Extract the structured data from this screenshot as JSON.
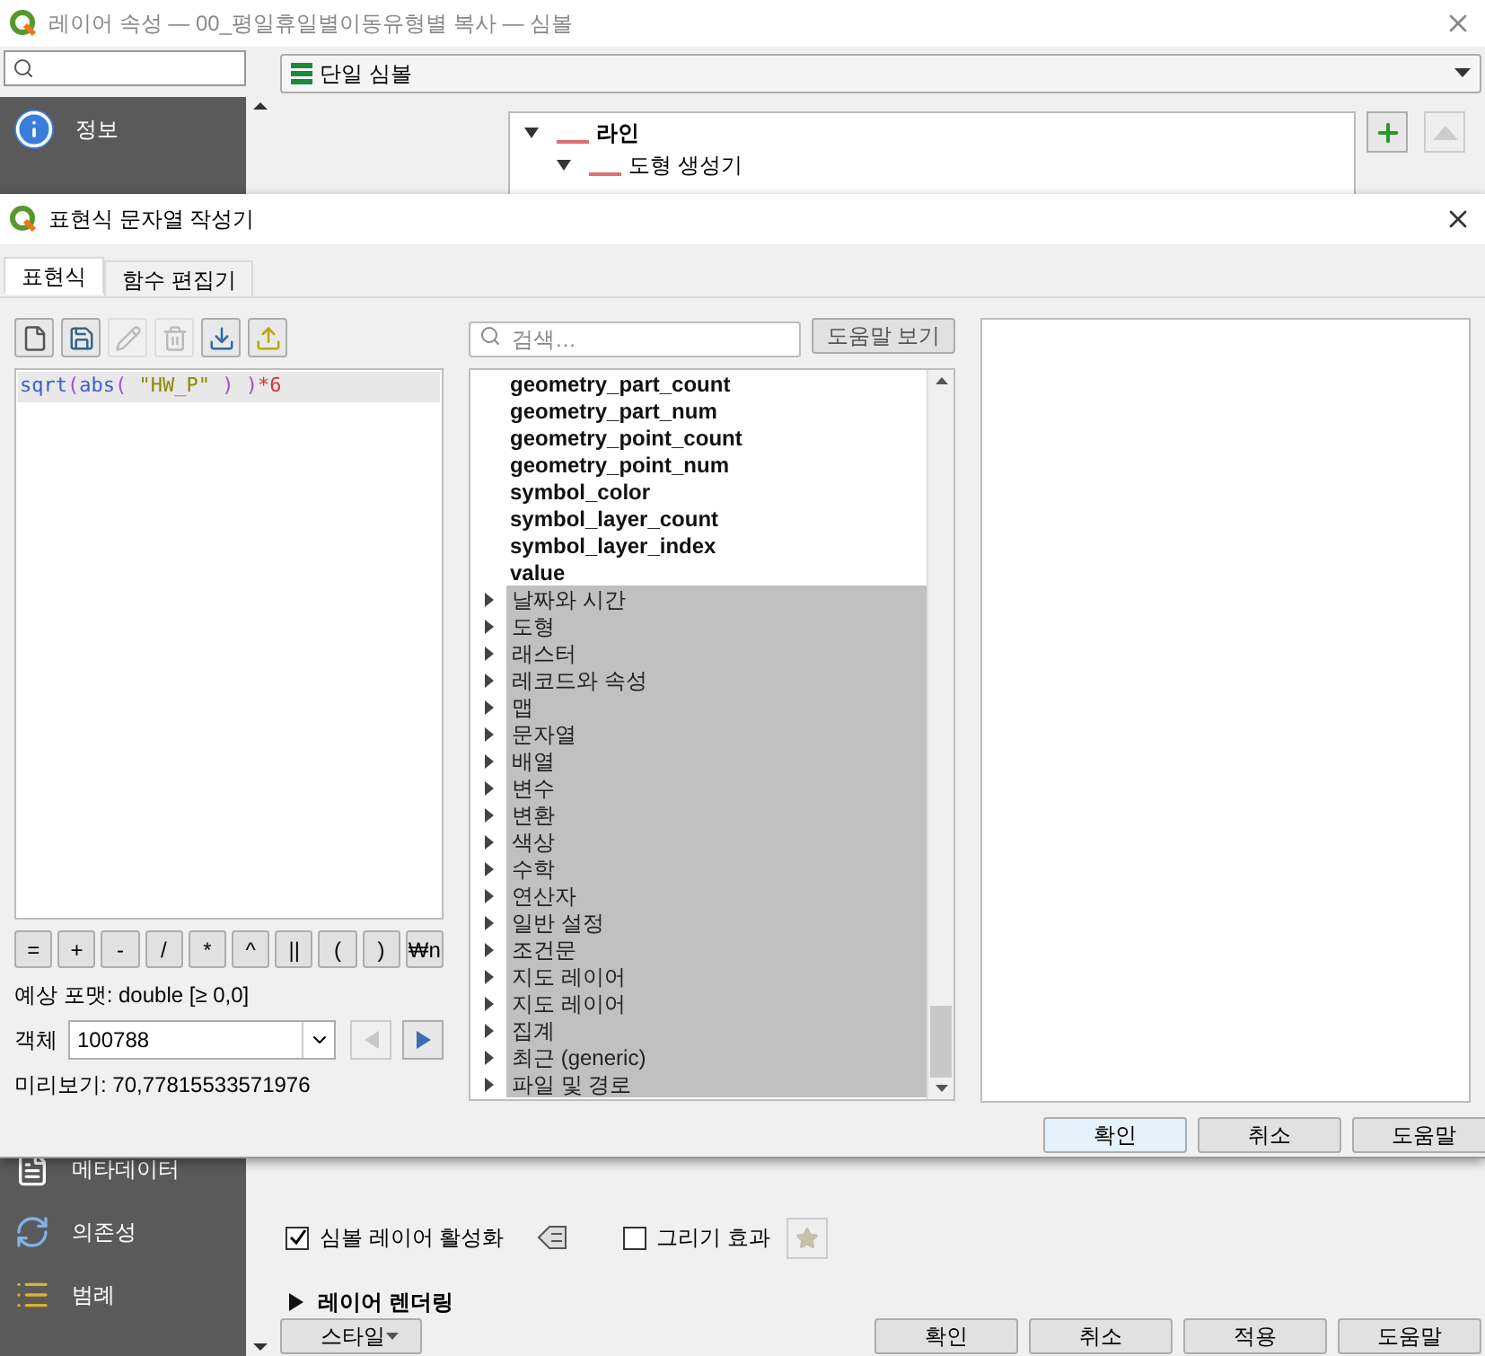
{
  "main_window": {
    "title": "레이어 속성 — 00_평일휴일별이동유형별 복사 — 심볼",
    "sidebar": {
      "top_items": [
        {
          "label": "정보",
          "kind": "info"
        }
      ],
      "bottom_items": [
        {
          "label": "메타데이터",
          "kind": "document"
        },
        {
          "label": "의존성",
          "kind": "sync"
        },
        {
          "label": "범례",
          "kind": "legend"
        }
      ]
    },
    "renderer": {
      "value": "단일 심볼"
    },
    "symbol_tree": [
      {
        "label": "라인",
        "expanded": true,
        "children": [
          {
            "label": "도형 생성기",
            "expanded": true
          }
        ]
      }
    ],
    "symbol_layer_enabled": {
      "label": "심볼 레이어 활성화",
      "checked": true
    },
    "draw_effects": {
      "label": "그리기 효과",
      "checked": false
    },
    "layer_rendering": {
      "label": "레이어 렌더링",
      "expanded": false
    },
    "style_button": "스타일",
    "buttons": [
      "확인",
      "취소",
      "적용",
      "도움말"
    ]
  },
  "dialog": {
    "title": "표현식 문자열 작성기",
    "tabs": [
      {
        "label": "표현식",
        "selected": true
      },
      {
        "label": "함수 편집기",
        "selected": false
      }
    ],
    "toolbar": [
      {
        "kind": "new",
        "disabled": false
      },
      {
        "kind": "save",
        "disabled": false
      },
      {
        "kind": "edit",
        "disabled": true
      },
      {
        "kind": "delete",
        "disabled": true
      },
      {
        "kind": "import",
        "disabled": false
      },
      {
        "kind": "export",
        "disabled": false
      }
    ],
    "expression": [
      {
        "text": "sqrt",
        "kind": "function"
      },
      {
        "text": "(",
        "kind": "paren"
      },
      {
        "text": "abs",
        "kind": "function"
      },
      {
        "text": "( ",
        "kind": "paren"
      },
      {
        "text": "\"HW_P\"",
        "kind": "field"
      },
      {
        "text": " ) )",
        "kind": "paren"
      },
      {
        "text": "*6",
        "kind": "number"
      }
    ],
    "operators": [
      "=",
      "+",
      "-",
      "/",
      "*",
      "^",
      "||",
      "(",
      ")",
      "₩n"
    ],
    "output_format": "예상 포맷: double [≥ 0,0]",
    "feature": {
      "label": "객체",
      "value": "100788",
      "prev_disabled": true,
      "next_disabled": false
    },
    "preview": "미리보기: 70,77815533571976",
    "search": {
      "placeholder": "검색…"
    },
    "help_button": "도움말 보기",
    "functions": [
      {
        "label": "geometry_part_count",
        "kind": "function"
      },
      {
        "label": "geometry_part_num",
        "kind": "function"
      },
      {
        "label": "geometry_point_count",
        "kind": "function"
      },
      {
        "label": "geometry_point_num",
        "kind": "function"
      },
      {
        "label": "symbol_color",
        "kind": "function"
      },
      {
        "label": "symbol_layer_count",
        "kind": "function"
      },
      {
        "label": "symbol_layer_index",
        "kind": "function"
      },
      {
        "label": "value",
        "kind": "function"
      },
      {
        "label": "날짜와 시간",
        "kind": "group",
        "expanded": false
      },
      {
        "label": "도형",
        "kind": "group",
        "expanded": false
      },
      {
        "label": "래스터",
        "kind": "group",
        "expanded": false
      },
      {
        "label": "레코드와 속성",
        "kind": "group",
        "expanded": false
      },
      {
        "label": "맵",
        "kind": "group",
        "expanded": false
      },
      {
        "label": "문자열",
        "kind": "group",
        "expanded": false
      },
      {
        "label": "배열",
        "kind": "group",
        "expanded": false
      },
      {
        "label": "변수",
        "kind": "group",
        "expanded": false
      },
      {
        "label": "변환",
        "kind": "group",
        "expanded": false
      },
      {
        "label": "색상",
        "kind": "group",
        "expanded": false
      },
      {
        "label": "수학",
        "kind": "group",
        "expanded": false
      },
      {
        "label": "연산자",
        "kind": "group",
        "expanded": false
      },
      {
        "label": "일반 설정",
        "kind": "group",
        "expanded": false
      },
      {
        "label": "조건문",
        "kind": "group",
        "expanded": false
      },
      {
        "label": "지도 레이어",
        "kind": "group",
        "expanded": false
      },
      {
        "label": "지도 레이어",
        "kind": "group",
        "expanded": false
      },
      {
        "label": "집계",
        "kind": "group",
        "expanded": false
      },
      {
        "label": "최근 (generic)",
        "kind": "group",
        "expanded": false
      },
      {
        "label": "파일 및 경로",
        "kind": "group",
        "expanded": false
      }
    ],
    "buttons": [
      {
        "label": "확인",
        "focused": true
      },
      {
        "label": "취소",
        "focused": false
      },
      {
        "label": "도움말",
        "focused": false
      }
    ]
  }
}
